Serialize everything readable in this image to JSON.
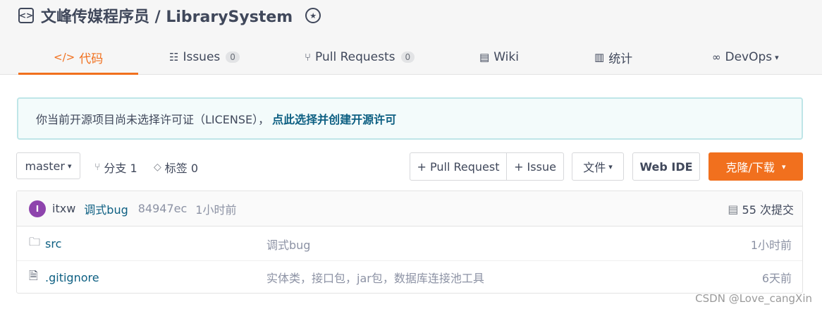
{
  "repo": {
    "title": "文峰传媒程序员 / LibrarySystem"
  },
  "tabs": [
    {
      "label": "代码",
      "icon": "code-icon"
    },
    {
      "label": "Issues",
      "count": "0",
      "icon": "issues-icon"
    },
    {
      "label": "Pull Requests",
      "count": "0",
      "icon": "pull-request-icon"
    },
    {
      "label": "Wiki",
      "icon": "wiki-icon"
    },
    {
      "label": "统计",
      "icon": "stats-icon"
    },
    {
      "label": "DevOps",
      "icon": "infinity-icon"
    }
  ],
  "notice": {
    "text": "你当前开源项目尚未选择许可证（LICENSE），",
    "link": "点此选择并创建开源许可"
  },
  "toolbar": {
    "branch": "master",
    "branches": "分支 1",
    "tags": "标签 0",
    "pull_request": "+ Pull Request",
    "issue": "+ Issue",
    "file": "文件",
    "web_ide": "Web IDE",
    "clone": "克隆/下载"
  },
  "commit": {
    "avatar": "I",
    "user": "itxw",
    "message": "调式bug",
    "sha": "84947ec",
    "time": "1小时前",
    "count": "55 次提交"
  },
  "files": [
    {
      "name": "src",
      "type": "folder",
      "message": "调式bug",
      "time": "1小时前"
    },
    {
      "name": ".gitignore",
      "type": "file",
      "message": "实体类，接口包，jar包，数据库连接池工具",
      "time": "6天前"
    }
  ],
  "watermark": "CSDN @Love_cangXin",
  "colors": {
    "accent": "#f1701e",
    "link": "#0d5f82",
    "avatar": "#8e44ad"
  }
}
